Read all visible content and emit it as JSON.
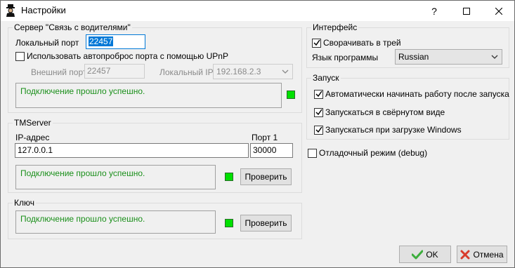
{
  "window": {
    "title": "Настройки",
    "help_label": "?",
    "colors": {
      "status_ok": "#1a8f1a",
      "led_ok": "#00e000",
      "accent": "#0078d7"
    }
  },
  "server": {
    "group_title": "Сервер \"Связь с водителями\"",
    "local_port_label": "Локальный порт",
    "local_port_value": "22457",
    "upnp_label": "Использовать автопроброс порта с помощью UPnP",
    "upnp_checked": false,
    "external_port_label": "Внешний порт",
    "external_port_value": "22457",
    "local_ip_label": "Локальный IP",
    "local_ip_value": "192.168.2.3",
    "status_text": "Подключение прошло успешно."
  },
  "tmserver": {
    "group_title": "TMServer",
    "ip_label": "IP-адрес",
    "ip_value": "127.0.0.1",
    "port_label": "Порт 1",
    "port_value": "30000",
    "status_text": "Подключение прошло успешно.",
    "check_label": "Проверить"
  },
  "key": {
    "group_title": "Ключ",
    "status_text": "Подключение прошло успешно.",
    "check_label": "Проверить"
  },
  "interface": {
    "group_title": "Интерфейс",
    "tray_label": "Сворачивать в трей",
    "tray_checked": true,
    "language_label": "Язык программы",
    "language_value": "Russian"
  },
  "launch": {
    "group_title": "Запуск",
    "items": [
      {
        "label": "Автоматически начинать работу после запуска",
        "checked": true
      },
      {
        "label": "Запускаться в свёрнутом виде",
        "checked": true
      },
      {
        "label": "Запускаться при загрузке Windows",
        "checked": true
      }
    ]
  },
  "debug": {
    "label": "Отладочный режим (debug)",
    "checked": false
  },
  "footer": {
    "ok_label": "OK",
    "cancel_label": "Отмена"
  }
}
